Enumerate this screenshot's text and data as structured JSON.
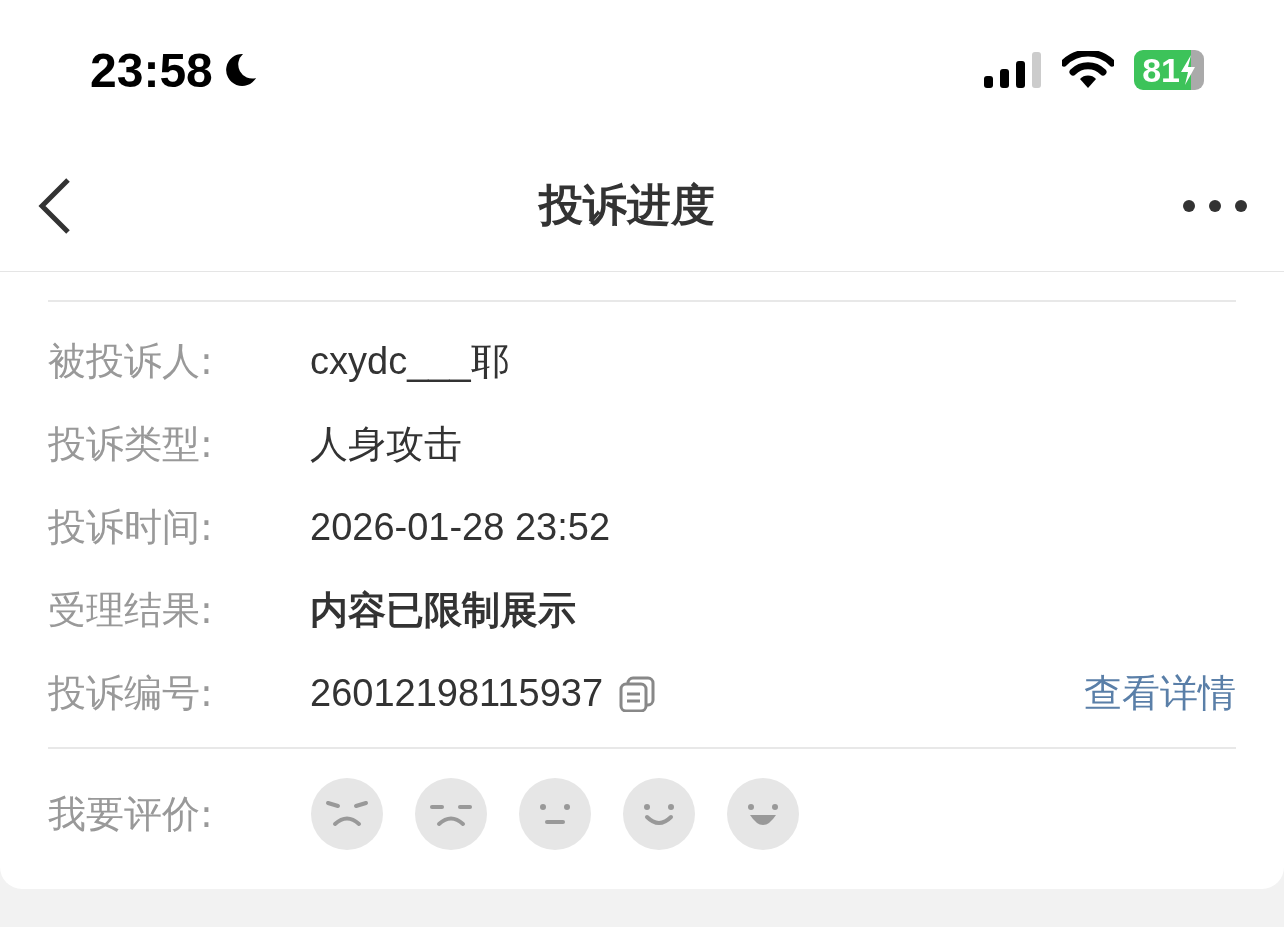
{
  "status_bar": {
    "time": "23:58",
    "battery": "81"
  },
  "nav": {
    "title": "投诉进度"
  },
  "details": [
    {
      "label": "被投诉人:",
      "value": "cxydc___耶",
      "kind": "text"
    },
    {
      "label": "投诉类型:",
      "value": "人身攻击",
      "kind": "text"
    },
    {
      "label": "投诉时间:",
      "value": "2026-01-28 23:52",
      "kind": "text"
    },
    {
      "label": "受理结果:",
      "value": "内容已限制展示",
      "kind": "bold"
    },
    {
      "label": "投诉编号:",
      "value": "26012198115937",
      "kind": "copy",
      "link": "查看详情"
    }
  ],
  "rating": {
    "label": "我要评价:",
    "faces": [
      {
        "kind": "angry",
        "selected": false
      },
      {
        "kind": "sad",
        "selected": false
      },
      {
        "kind": "neutral",
        "selected": false
      },
      {
        "kind": "smile",
        "selected": false
      },
      {
        "kind": "happy",
        "selected": false
      }
    ]
  }
}
